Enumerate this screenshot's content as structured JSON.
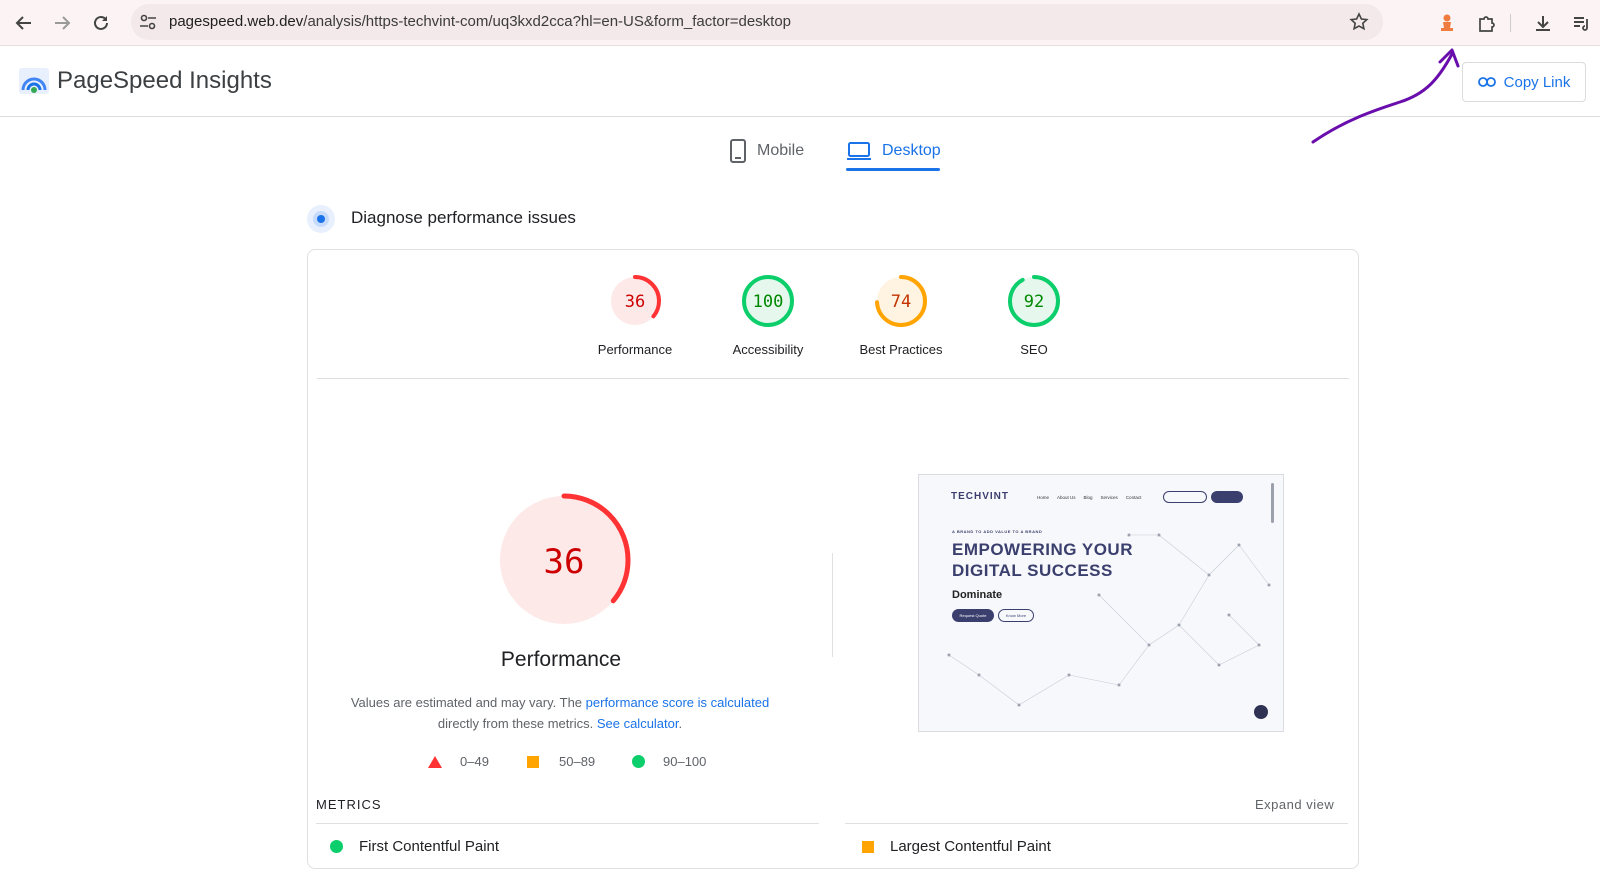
{
  "browser": {
    "url_host": "pagespeed.web.dev",
    "url_path": "/analysis/https-techvint-com/uq3kxd2cca?hl=en-US&form_factor=desktop"
  },
  "app": {
    "title": "PageSpeed Insights",
    "copy_link_label": "Copy Link"
  },
  "tabs": [
    {
      "label": "Mobile",
      "active": false
    },
    {
      "label": "Desktop",
      "active": true
    }
  ],
  "diagnose": {
    "title": "Diagnose performance issues"
  },
  "categories": [
    {
      "label": "Performance",
      "score": "36",
      "value": 36,
      "color": "#ff3333",
      "bg": "#fde9e8"
    },
    {
      "label": "Accessibility",
      "score": "100",
      "value": 100,
      "color": "#0cce6b",
      "bg": "#e6f8ee"
    },
    {
      "label": "Best Practices",
      "score": "74",
      "value": 74,
      "color": "#ffa400",
      "bg": "#fff4e2"
    },
    {
      "label": "SEO",
      "score": "92",
      "value": 92,
      "color": "#0cce6b",
      "bg": "#e6f8ee"
    }
  ],
  "main_score": {
    "score": "36",
    "value": 36,
    "label": "Performance",
    "color": "#ff3333"
  },
  "note": {
    "text1": "Values are estimated and may vary. The ",
    "link1": "performance score is calculated",
    "text2": "directly from these metrics.",
    "link2": "See calculator",
    "text3": "."
  },
  "legend": [
    {
      "range": "0–49",
      "shape": "triangle",
      "color": "#ff3333"
    },
    {
      "range": "50–89",
      "shape": "square",
      "color": "#ffa400"
    },
    {
      "range": "90–100",
      "shape": "circle",
      "color": "#0cce6b"
    }
  ],
  "screenshot": {
    "brand": "TECHVINT",
    "tagline": "A BRAND TO ADD VALUE TO A BRAND",
    "nav": [
      "Home",
      "About Us",
      "Blog",
      "Services",
      "Contact"
    ],
    "headline1": "EMPOWERING YOUR",
    "headline2": "DIGITAL SUCCESS",
    "subheadline": "Dominate",
    "btn1": "Request Quote",
    "btn2": "Know More"
  },
  "metrics": {
    "title": "METRICS",
    "expand_label": "Expand view",
    "items": [
      {
        "label": "First Contentful Paint",
        "color": "#0cce6b"
      },
      {
        "label": "Largest Contentful Paint",
        "color": "#ffa400"
      }
    ]
  },
  "colors": {
    "accent": "#1a73e8",
    "annotation": "#6a0dad"
  }
}
